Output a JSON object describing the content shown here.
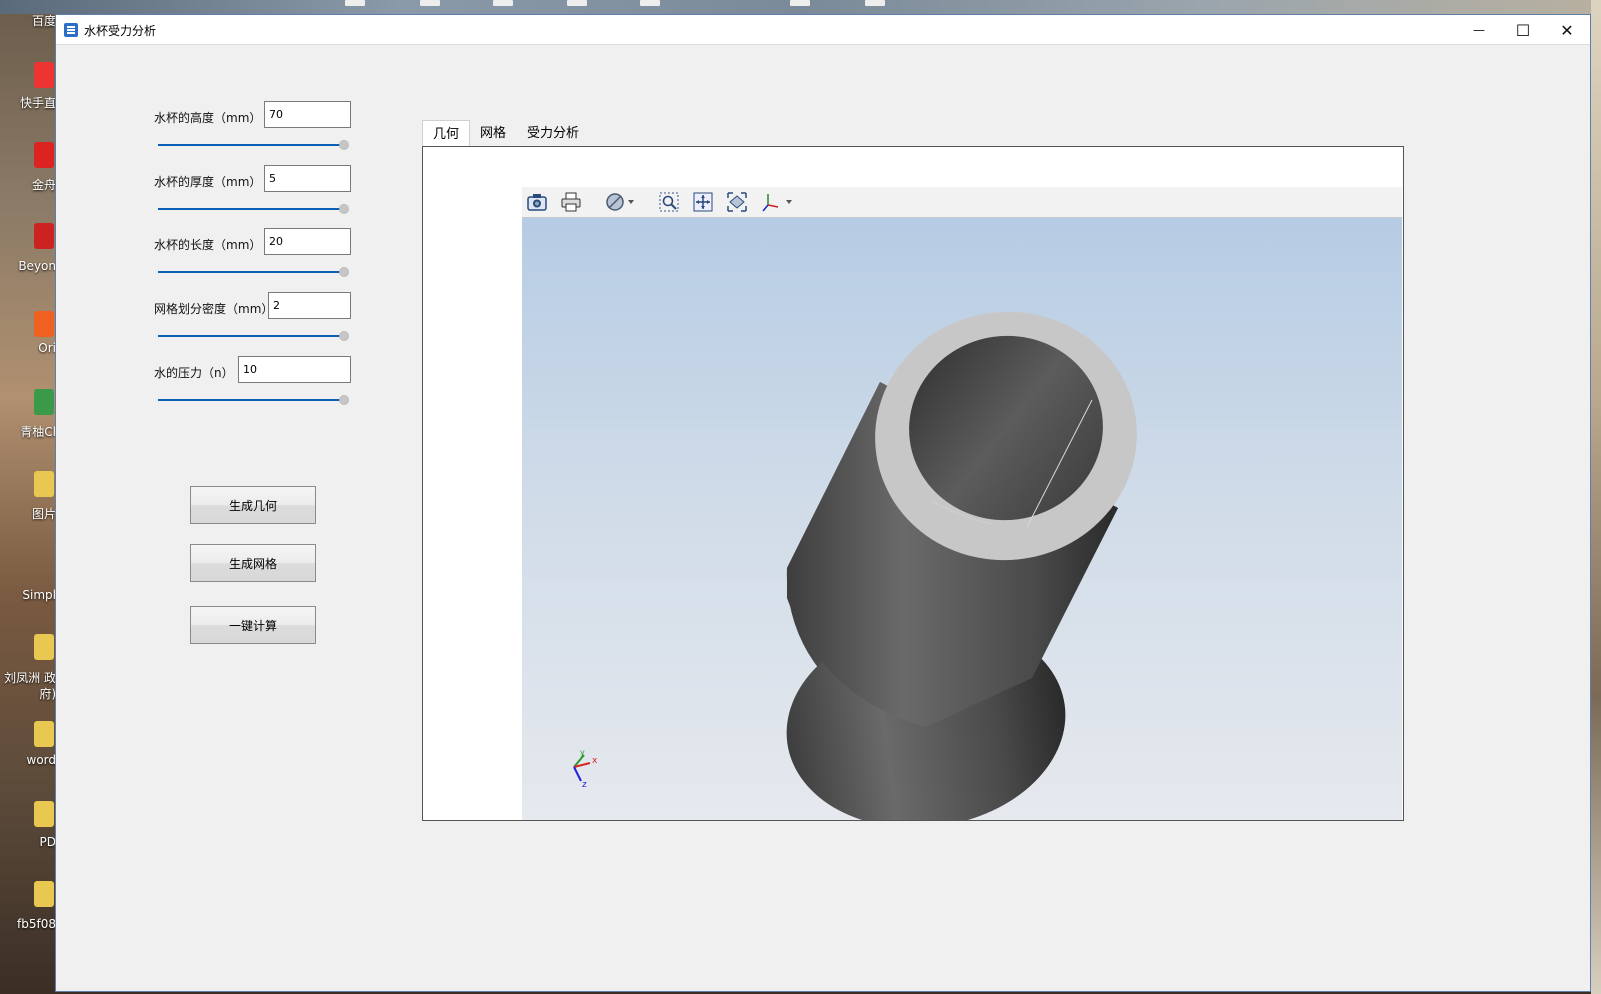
{
  "window": {
    "title": "水杯受力分析"
  },
  "window_controls": {
    "minimize": "—",
    "maximize": "☐",
    "close": "✕"
  },
  "desktop_labels": [
    "百度",
    "快手直",
    "金舟",
    "Beyon",
    "Ori",
    "青柚Cl",
    "图片",
    "Simpl",
    "刘凤洲 政府)",
    "word",
    "PD",
    "fb5f08"
  ],
  "form": {
    "fields": [
      {
        "label": "水杯的高度（mm）",
        "value": "70"
      },
      {
        "label": "水杯的厚度（mm）",
        "value": "5"
      },
      {
        "label": "水杯的长度（mm）",
        "value": "20"
      },
      {
        "label": "网格划分密度（mm）",
        "value": "2"
      },
      {
        "label": "水的压力（n）",
        "value": "10"
      }
    ],
    "buttons": {
      "gen_geometry": "生成几何",
      "gen_mesh": "生成网格",
      "compute": "一键计算"
    }
  },
  "tabs": [
    "几何",
    "网格",
    "受力分析"
  ],
  "active_tab": "几何",
  "toolbar_icons": [
    "camera-icon",
    "print-icon",
    "display-mode-icon",
    "zoom-window-icon",
    "fit-all-icon",
    "view-fit-icon",
    "axis-orientation-icon"
  ],
  "axis_triad": {
    "x": "x",
    "y": "y",
    "z": "z"
  },
  "colors": {
    "accent": "#0a5fb4",
    "viewport_top": "#b6cce4",
    "viewport_bottom": "#e6e9ee",
    "model": "#5a5a5a",
    "rim": "#c8c8c8"
  }
}
